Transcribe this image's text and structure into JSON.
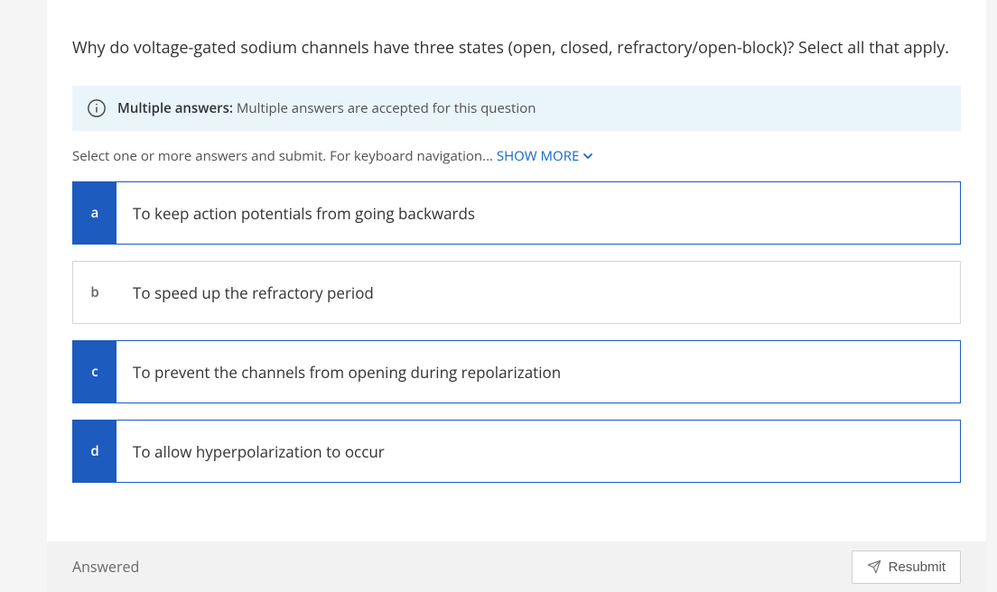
{
  "question": "Why do voltage-gated sodium channels have three states (open, closed, refractory/open-block)? Select all that apply.",
  "banner": {
    "bold": "Multiple answers:",
    "rest": "Multiple answers are accepted for this question"
  },
  "instruction": {
    "lead": "Select one or more answers and submit. For keyboard navigation...",
    "link": "SHOW MORE"
  },
  "answers": [
    {
      "letter": "a",
      "text": "To keep action potentials from going backwards",
      "selected": true
    },
    {
      "letter": "b",
      "text": "To speed up the refractory period",
      "selected": false
    },
    {
      "letter": "c",
      "text": "To prevent the channels from opening during repolarization",
      "selected": true
    },
    {
      "letter": "d",
      "text": "To allow hyperpolarization to occur",
      "selected": true
    }
  ],
  "footer": {
    "status": "Answered",
    "button": "Resubmit"
  }
}
